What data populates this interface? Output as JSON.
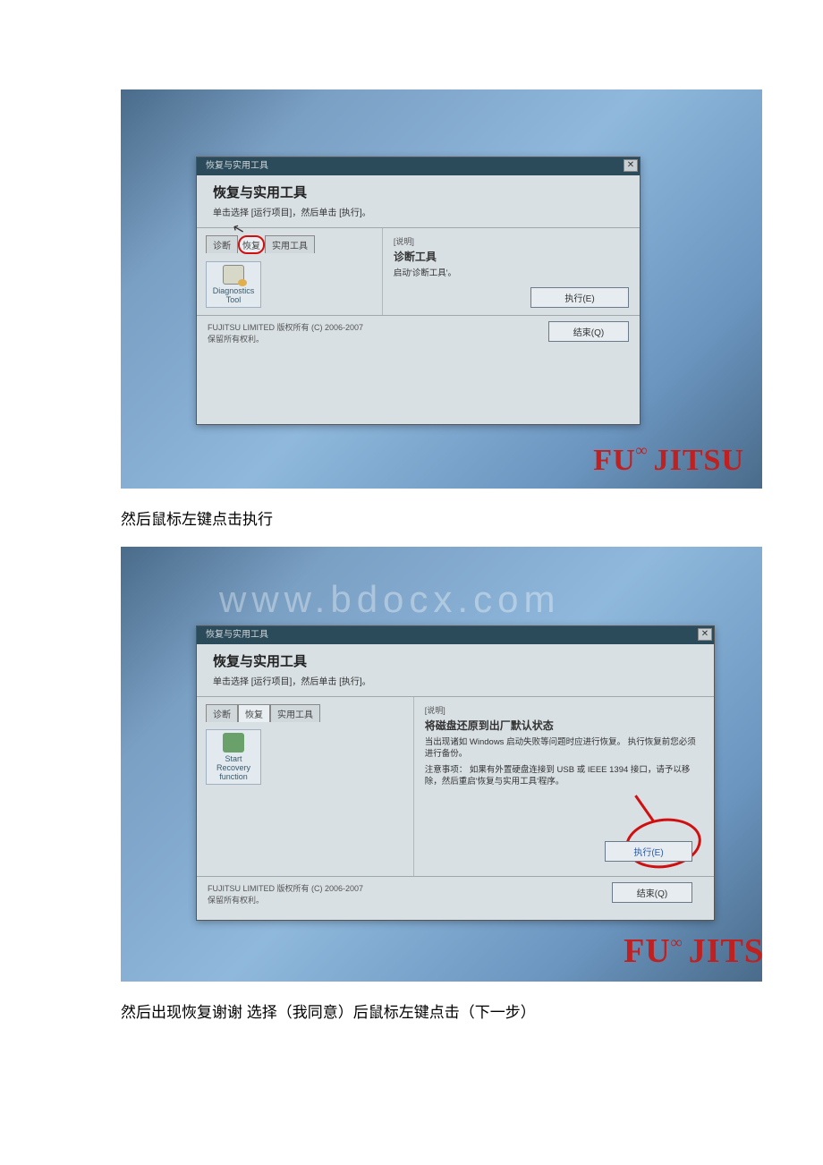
{
  "watermark": "www.bdocx.com",
  "caption1": "然后鼠标左键点击执行",
  "caption2": "然后出现恢复谢谢 选择（我同意）后鼠标左键点击（下一步）",
  "window": {
    "titlebar": "恢复与实用工具",
    "close": "✕",
    "heading": "恢复与实用工具",
    "subheading": "单击选择 [运行项目]，然后单击 [执行]。",
    "tabs": {
      "diag": "诊断",
      "recover": "恢复",
      "util": "实用工具"
    },
    "tool1": {
      "name": "Diagnostics Tool"
    },
    "tool2": {
      "line1": "Start",
      "line2": "Recovery",
      "line3": "function"
    },
    "desc_label": "[说明]",
    "panel1": {
      "title": "诊断工具",
      "line": "启动'诊断工具'。"
    },
    "panel2": {
      "title": "将磁盘还原到出厂默认状态",
      "p1": "当出现诸如 Windows 启动失败等问题时应进行恢复。 执行恢复前您必须进行备份。",
      "p2": "注意事项： 如果有外置硬盘连接到 USB 或 IEEE 1394 接口，请予以移除，然后重启'恢复与实用工具'程序。"
    },
    "exec_btn": "执行(E)",
    "end_btn": "结束(Q)",
    "copyright1": "FUJITSU LIMITED 版权所有 (C) 2006-2007",
    "copyright2": "保留所有权利。"
  },
  "brand": "FUJITSU",
  "brand_cut": "FUJITS"
}
